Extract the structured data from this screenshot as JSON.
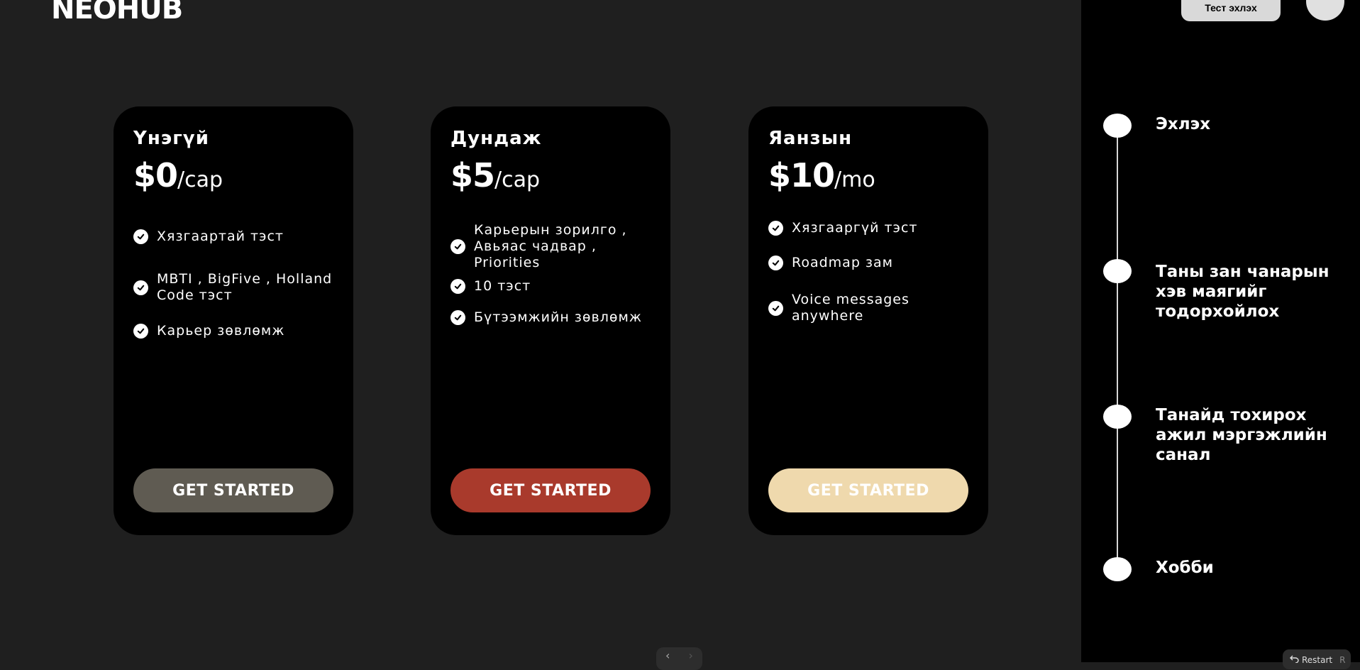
{
  "brand": {
    "logo": "NEOHUB"
  },
  "header": {
    "start_test_label": "Тест эхлэх"
  },
  "plans": [
    {
      "name": "Үнэгүй",
      "amount": "$0",
      "period": "/сар",
      "features": [
        "Хязгаартай тэст",
        "MBTI , BigFive , Holland Code тэст",
        "Карьер зөвлөмж"
      ],
      "cta": "GET STARTED",
      "cta_color": "#5f5b52",
      "cta_text_color": "#ffffff"
    },
    {
      "name": "Дундаж",
      "amount": "$5",
      "period": "/сар",
      "features": [
        "Карьерын зорилго , Авьяас чадвар , Priorities",
        "10  тэст",
        "Бүтээмжийн зөвлөмж"
      ],
      "cta": "GET STARTED",
      "cta_color": "#a93a2c",
      "cta_text_color": "#ffffff"
    },
    {
      "name": "Яанзын",
      "amount": "$10",
      "period": "/mo",
      "features": [
        "Хязгааргүй тэст",
        "Roadmap зам",
        "Voice messages anywhere"
      ],
      "cta": "GET STARTED",
      "cta_color": "#efd9ad",
      "cta_text_color": "#ffffff"
    }
  ],
  "timeline": {
    "steps": [
      "Эхлэх",
      "Таны зан чанарын хэв маягийг тодорхойлох",
      "Танайд тохирох ажил мэргэжлийн санал",
      "Хобби"
    ]
  },
  "pager": {
    "prev": "‹",
    "next": "›"
  },
  "restart": {
    "label": "Restart",
    "key": "R",
    "icon": "undo-icon"
  }
}
